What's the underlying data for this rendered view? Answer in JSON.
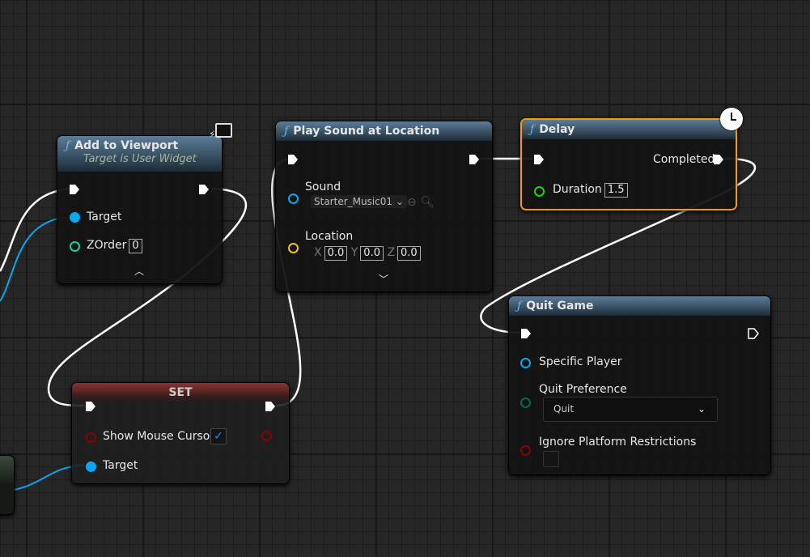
{
  "nodes": {
    "add_to_viewport": {
      "title": "Add to Viewport",
      "subtitle": "Target is User Widget",
      "target": "Target",
      "zorder_label": "ZOrder",
      "zorder_value": "0"
    },
    "play_sound": {
      "title": "Play Sound at Location",
      "sound_label": "Sound",
      "sound_value": "Starter_Music01",
      "location_label": "Location",
      "x_label": "X",
      "x": "0.0",
      "y_label": "Y",
      "y": "0.0",
      "z_label": "Z",
      "z": "0.0"
    },
    "delay": {
      "title": "Delay",
      "completed": "Completed",
      "duration_label": "Duration",
      "duration_value": "1.5"
    },
    "quit_game": {
      "title": "Quit Game",
      "specific_player": "Specific Player",
      "quit_preference": "Quit Preference",
      "quit_preference_value": "Quit",
      "ignore_platform": "Ignore Platform Restrictions",
      "ignore_platform_checked": false
    },
    "set": {
      "title": "SET",
      "show_mouse_cursor": "Show Mouse Cursor",
      "show_mouse_cursor_checked": true,
      "target": "Target"
    }
  },
  "colors": {
    "exec": "#ffffff",
    "object": "#0aa6f0",
    "int": "#1fcf9c",
    "float": "#22d016",
    "vector": "#f0c020",
    "bool": "#8b0000",
    "enum": "#00665e",
    "selected": "#f29b0c"
  }
}
